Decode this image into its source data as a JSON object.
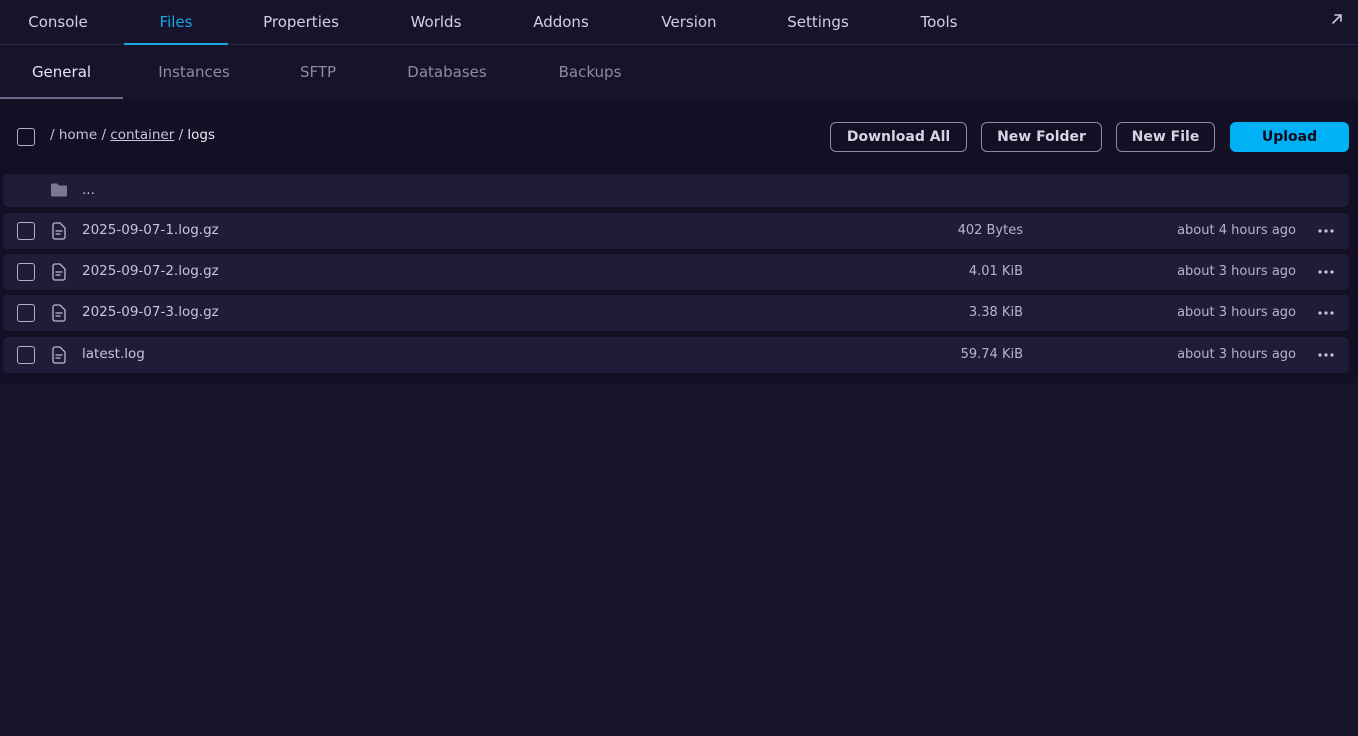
{
  "top_tabs": [
    "Console",
    "Files",
    "Properties",
    "Worlds",
    "Addons",
    "Version",
    "Settings",
    "Tools"
  ],
  "top_tabs_active": "Files",
  "sub_tabs": [
    "General",
    "Instances",
    "SFTP",
    "Databases",
    "Backups"
  ],
  "sub_tabs_active": "General",
  "breadcrumb": {
    "sep": "/",
    "home": "home",
    "container": "container",
    "current": "logs"
  },
  "actions": {
    "download_all": "Download All",
    "new_folder": "New Folder",
    "new_file": "New File",
    "upload": "Upload"
  },
  "parent_dir": "...",
  "files": [
    {
      "name": "2025-09-07-1.log.gz",
      "size": "402 Bytes",
      "modified": "about 4 hours ago"
    },
    {
      "name": "2025-09-07-2.log.gz",
      "size": "4.01 KiB",
      "modified": "about 3 hours ago"
    },
    {
      "name": "2025-09-07-3.log.gz",
      "size": "3.38 KiB",
      "modified": "about 3 hours ago"
    },
    {
      "name": "latest.log",
      "size": "59.74 KiB",
      "modified": "about 3 hours ago"
    }
  ],
  "colors": {
    "background": "#17132a",
    "accent": "#1aa7e6",
    "upload_button": "#00b2f5",
    "row": "#211b3a"
  },
  "icons": [
    "expand-arrow-icon",
    "folder-icon",
    "file-text-icon",
    "more-horizontal-icon"
  ]
}
